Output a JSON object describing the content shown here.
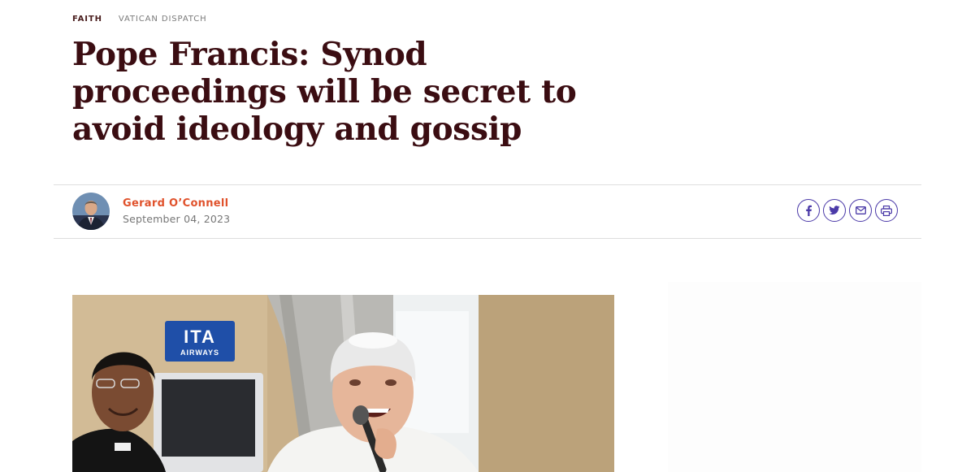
{
  "breadcrumb": {
    "section": "FAITH",
    "subsection": "VATICAN DISPATCH"
  },
  "article": {
    "headline": "Pope Francis: Synod proceedings will be secret to avoid ideology and gossip",
    "author": "Gerard O’Connell",
    "date": "September 04, 2023"
  },
  "share": {
    "icons": [
      "facebook-icon",
      "twitter-icon",
      "email-icon",
      "print-icon"
    ]
  },
  "hero": {
    "sign_brand": "ITA",
    "sign_sub": "AIRWAYS"
  },
  "colors": {
    "headline": "#3b0d12",
    "author": "#e0522c",
    "share_accent": "#4b3aa8"
  }
}
